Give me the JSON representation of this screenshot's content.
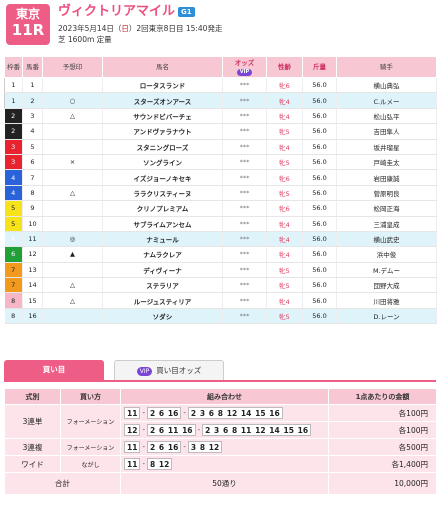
{
  "header": {
    "venue": "東京",
    "race_no": "11R",
    "title": "ヴィクトリアマイル",
    "grade": "G1",
    "date": "2023年5月14日（",
    "weekday": "日",
    "info_rest": "）2回東京8日目 15:40発走",
    "course": "芝 1600m 定量"
  },
  "columns": {
    "waku": "枠番",
    "num": "馬番",
    "pred": "予想印",
    "name": "馬名",
    "odds": "オッズ",
    "odds_vip": "VIP",
    "sexage": "性齢",
    "weight": "斤量",
    "jockey": "騎手"
  },
  "entries": [
    {
      "waku": "1",
      "num": "1",
      "mark": "",
      "name": "ロータスランド",
      "odds": "***",
      "sexage": "牝6",
      "weight": "56.0",
      "jockey": "横山典弘",
      "w": "w1",
      "hl": false
    },
    {
      "waku": "1",
      "num": "2",
      "mark": "○",
      "name": "スターズオンアース",
      "odds": "***",
      "sexage": "牝4",
      "weight": "56.0",
      "jockey": "C.ルメー",
      "w": "w1",
      "hl": true
    },
    {
      "waku": "2",
      "num": "3",
      "mark": "△",
      "name": "サウンドビバーチェ",
      "odds": "***",
      "sexage": "牝4",
      "weight": "56.0",
      "jockey": "松山弘平",
      "w": "w2",
      "hl": false
    },
    {
      "waku": "2",
      "num": "4",
      "mark": "",
      "name": "アンドヴァラナウト",
      "odds": "***",
      "sexage": "牝5",
      "weight": "56.0",
      "jockey": "吉田隼人",
      "w": "w2",
      "hl": false
    },
    {
      "waku": "3",
      "num": "5",
      "mark": "",
      "name": "スタニングローズ",
      "odds": "***",
      "sexage": "牝4",
      "weight": "56.0",
      "jockey": "坂井瑠星",
      "w": "w3",
      "hl": false
    },
    {
      "waku": "3",
      "num": "6",
      "mark": "×",
      "name": "ソングライン",
      "odds": "***",
      "sexage": "牝5",
      "weight": "56.0",
      "jockey": "戸崎圭太",
      "w": "w3",
      "hl": false
    },
    {
      "waku": "4",
      "num": "7",
      "mark": "",
      "name": "イズジョーノキセキ",
      "odds": "***",
      "sexage": "牝6",
      "weight": "56.0",
      "jockey": "岩田康誠",
      "w": "w4",
      "hl": false
    },
    {
      "waku": "4",
      "num": "8",
      "mark": "△",
      "name": "ララクリスティーヌ",
      "odds": "***",
      "sexage": "牝5",
      "weight": "56.0",
      "jockey": "菅原明良",
      "w": "w4",
      "hl": false
    },
    {
      "waku": "5",
      "num": "9",
      "mark": "",
      "name": "クリノプレミアム",
      "odds": "***",
      "sexage": "牝6",
      "weight": "56.0",
      "jockey": "松岡正海",
      "w": "w5",
      "hl": false
    },
    {
      "waku": "5",
      "num": "10",
      "mark": "",
      "name": "サブライムアンセム",
      "odds": "***",
      "sexage": "牝4",
      "weight": "56.0",
      "jockey": "三浦皇成",
      "w": "w5",
      "hl": false
    },
    {
      "waku": "6",
      "num": "11",
      "mark": "◎",
      "name": "ナミュール",
      "odds": "***",
      "sexage": "牝4",
      "weight": "56.0",
      "jockey": "横山武史",
      "w": "w6",
      "hl": true
    },
    {
      "waku": "6",
      "num": "12",
      "mark": "▲",
      "name": "ナムラクレア",
      "odds": "***",
      "sexage": "牝4",
      "weight": "56.0",
      "jockey": "浜中俊",
      "w": "w6",
      "hl": false
    },
    {
      "waku": "7",
      "num": "13",
      "mark": "",
      "name": "ディヴィーナ",
      "odds": "***",
      "sexage": "牝5",
      "weight": "56.0",
      "jockey": "M.デムー",
      "w": "w7",
      "hl": false
    },
    {
      "waku": "7",
      "num": "14",
      "mark": "△",
      "name": "ステラリア",
      "odds": "***",
      "sexage": "牝5",
      "weight": "56.0",
      "jockey": "団野大成",
      "w": "w7",
      "hl": false
    },
    {
      "waku": "8",
      "num": "15",
      "mark": "△",
      "name": "ルージュスティリア",
      "odds": "***",
      "sexage": "牝4",
      "weight": "56.0",
      "jockey": "川田将雅",
      "w": "w8",
      "hl": false
    },
    {
      "waku": "8",
      "num": "16",
      "mark": "",
      "name": "ソダシ",
      "odds": "***",
      "sexage": "牝5",
      "weight": "56.0",
      "jockey": "D.レーン",
      "w": "w8",
      "hl": true
    }
  ],
  "tabs": {
    "buy": "買い目",
    "vip_badge": "VIP",
    "buy_odds": "買い目オッズ"
  },
  "bets_header": {
    "type": "式別",
    "method": "買い方",
    "combo": "組み合わせ",
    "amount": "1点あたりの金額"
  },
  "bets": [
    {
      "type": "3連単",
      "method": "フォーメーション",
      "rows": [
        [
          "11",
          "2 6 16",
          "2 3 6 8 12 14 15 16"
        ],
        [
          "12",
          "2 6 11 16",
          "2 3 6 8 11 12 14 15 16"
        ]
      ],
      "amounts": [
        "各100円",
        "各100円"
      ]
    },
    {
      "type": "3連複",
      "method": "フォーメーション",
      "rows": [
        [
          "11",
          "2 6 16",
          "3 8 12"
        ]
      ],
      "amounts": [
        "各500円"
      ]
    },
    {
      "type": "ワイド",
      "method": "ながし",
      "rows": [
        [
          "11",
          "8 12"
        ]
      ],
      "amounts": [
        "各1,400円"
      ]
    }
  ],
  "totals": {
    "label": "合計",
    "count": "50通り",
    "amount": "10,000円"
  },
  "colors": {
    "accent": "#ee5d86",
    "header_bg": "#f7c7d3",
    "bet_bg": "#fde4ea",
    "highlight": "#dff3fb"
  }
}
